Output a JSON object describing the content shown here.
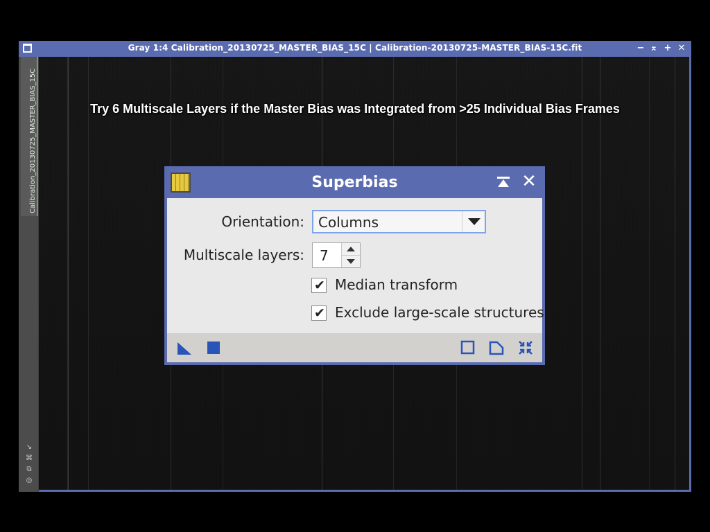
{
  "window": {
    "title": "Gray 1:4 Calibration_20130725_MASTER_BIAS_15C | Calibration-20130725-MASTER_BIAS-15C.fit",
    "tab_label": "Calibration_20130725_MASTER_BIAS_15C",
    "controls": {
      "minimize": "−",
      "shade": "⌅",
      "maximize": "+",
      "close": "✕"
    },
    "accent_color": "#5b6bb0"
  },
  "caption": "Try 6 Multiscale Layers if the Master Bias was Integrated from >25 Individual Bias Frames",
  "dialog": {
    "title": "Superbias",
    "icon": "superbias-process-icon",
    "orientation": {
      "label": "Orientation:",
      "value": "Columns"
    },
    "multiscale_layers": {
      "label": "Multiscale layers:",
      "value": "7"
    },
    "median_transform": {
      "label": "Median transform",
      "checked": true
    },
    "exclude_large_scale": {
      "label": "Exclude large-scale structures",
      "checked": true
    },
    "check_glyph": "✔",
    "footer_icons": [
      "new-instance-icon",
      "apply-global-icon",
      "reset-icon",
      "documentation-icon",
      "preferences-icon"
    ]
  }
}
